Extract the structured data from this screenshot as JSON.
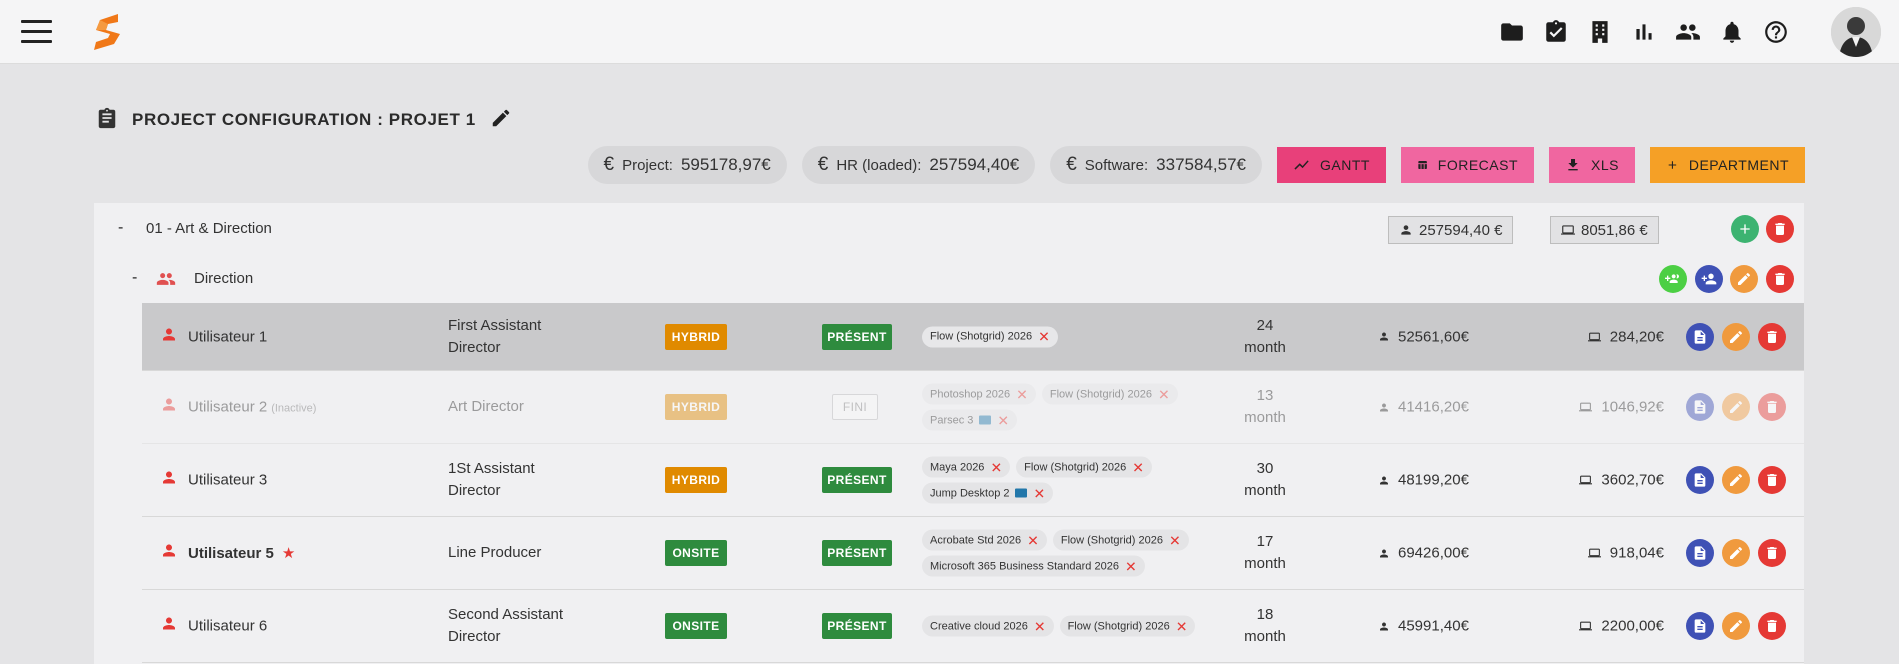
{
  "topbar": {
    "icons": [
      "folder-icon",
      "clipboard-check-icon",
      "building-icon",
      "bar-chart-icon",
      "people-icon",
      "bell-icon",
      "help-icon"
    ]
  },
  "title": {
    "text": "PROJECT CONFIGURATION : PROJET 1"
  },
  "summary": {
    "project_label": "Project:",
    "project_value": "595178,97€",
    "hr_label": "HR (loaded):",
    "hr_value": "257594,40€",
    "software_label": "Software:",
    "software_value": "337584,57€"
  },
  "buttons": {
    "gantt": "GANTT",
    "forecast": "FORECAST",
    "xls": "XLS",
    "department": "DEPARTMENT"
  },
  "department": {
    "name": "01 - Art & Direction",
    "hr_total": "257594,40 €",
    "software_total": "8051,86 €"
  },
  "team": {
    "name": "Direction"
  },
  "users": [
    {
      "name": "Utilisateur 1",
      "note": "",
      "role": "First Assistant Director",
      "mode": "HYBRID",
      "status": "PRÉSENT",
      "tags": [
        "Flow (Shotgrid) 2026"
      ],
      "duration_value": "24",
      "duration_unit": "month",
      "hr": "52561,60€",
      "software": "284,20€"
    },
    {
      "name": "Utilisateur 2",
      "note": "(Inactive)",
      "role": "Art Director",
      "mode": "HYBRID",
      "status": "FINI",
      "tags": [
        "Photoshop 2026",
        "Flow (Shotgrid) 2026",
        "Parsec 3"
      ],
      "duration_value": "13",
      "duration_unit": "month",
      "hr": "41416,20€",
      "software": "1046,92€"
    },
    {
      "name": "Utilisateur 3",
      "note": "",
      "role": "1St Assistant Director",
      "mode": "HYBRID",
      "status": "PRÉSENT",
      "tags": [
        "Maya 2026",
        "Flow (Shotgrid) 2026",
        "Jump Desktop 2"
      ],
      "duration_value": "30",
      "duration_unit": "month",
      "hr": "48199,20€",
      "software": "3602,70€"
    },
    {
      "name": "Utilisateur 5",
      "note": "",
      "role": "Line Producer",
      "mode": "ONSITE",
      "status": "PRÉSENT",
      "tags": [
        "Acrobate Std 2026",
        "Flow (Shotgrid) 2026",
        "Microsoft 365 Business Standard 2026"
      ],
      "duration_value": "17",
      "duration_unit": "month",
      "hr": "69426,00€",
      "software": "918,04€"
    },
    {
      "name": "Utilisateur 6",
      "note": "",
      "role": "Second Assistant Director",
      "mode": "ONSITE",
      "status": "PRÉSENT",
      "tags": [
        "Creative cloud 2026",
        "Flow (Shotgrid) 2026"
      ],
      "duration_value": "18",
      "duration_unit": "month",
      "hr": "45991,40€",
      "software": "2200,00€"
    }
  ],
  "colors": {
    "accent_pink": "#e8407a",
    "accent_orange": "#f5a026",
    "present_green": "#2e8b3e",
    "hybrid_orange": "#e08a00",
    "delete_red": "#e53935",
    "doc_blue": "#3f51b5"
  }
}
